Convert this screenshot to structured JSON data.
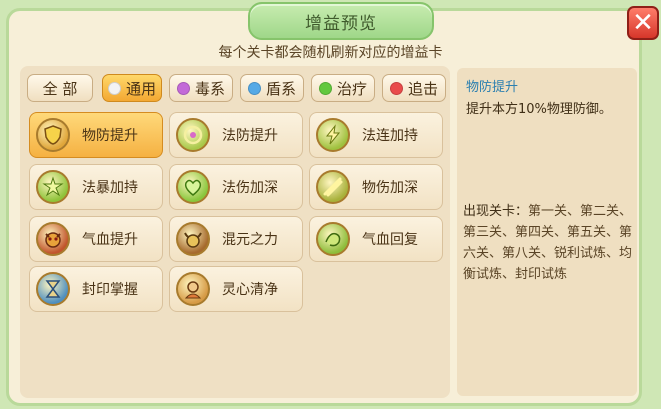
{
  "window": {
    "title": "增益预览",
    "close_icon": "close-icon"
  },
  "subtitle": "每个关卡都会随机刷新对应的增益卡",
  "tabs": [
    {
      "label": "全 部",
      "dot": null,
      "active": false
    },
    {
      "label": "通用",
      "dot": "#f3f3f3",
      "active": true
    },
    {
      "label": "毒系",
      "dot": "#c36ad8",
      "active": false
    },
    {
      "label": "盾系",
      "dot": "#55a9e6",
      "active": false
    },
    {
      "label": "治疗",
      "dot": "#62c83e",
      "active": false
    },
    {
      "label": "追击",
      "dot": "#e94b4b",
      "active": false
    }
  ],
  "cards": [
    {
      "label": "物防提升",
      "icon": "shield-icon",
      "color": "#e0a63a",
      "active": true
    },
    {
      "label": "法防提升",
      "icon": "swirl-icon",
      "color": "#a9c84a",
      "active": false
    },
    {
      "label": "法连加持",
      "icon": "lightning-icon",
      "color": "#9fc13e",
      "active": false
    },
    {
      "label": "法暴加持",
      "icon": "burst-icon",
      "color": "#8fc33a",
      "active": false
    },
    {
      "label": "法伤加深",
      "icon": "heart-icon",
      "color": "#89c63c",
      "active": false
    },
    {
      "label": "物伤加深",
      "icon": "slash-icon",
      "color": "#a8b13a",
      "active": false
    },
    {
      "label": "气血提升",
      "icon": "demon-mask-icon",
      "color": "#c1552c",
      "active": false
    },
    {
      "label": "混元之力",
      "icon": "bull-head-icon",
      "color": "#a66a2e",
      "active": false
    },
    {
      "label": "气血回复",
      "icon": "dragon-icon",
      "color": "#8ebd3b",
      "active": false
    },
    {
      "label": "封印掌握",
      "icon": "hourglass-icon",
      "color": "#4f8fbf",
      "active": false
    },
    {
      "label": "灵心清净",
      "icon": "monk-icon",
      "color": "#d69a45",
      "active": false
    }
  ],
  "detail": {
    "name": "物防提升",
    "description": "提升本方10%物理防御。",
    "appear_label": "出现关卡：",
    "appear_list": "第一关、第二关、第三关、第四关、第五关、第六关、第八关、锐利试炼、均衡试炼、封印试炼"
  }
}
